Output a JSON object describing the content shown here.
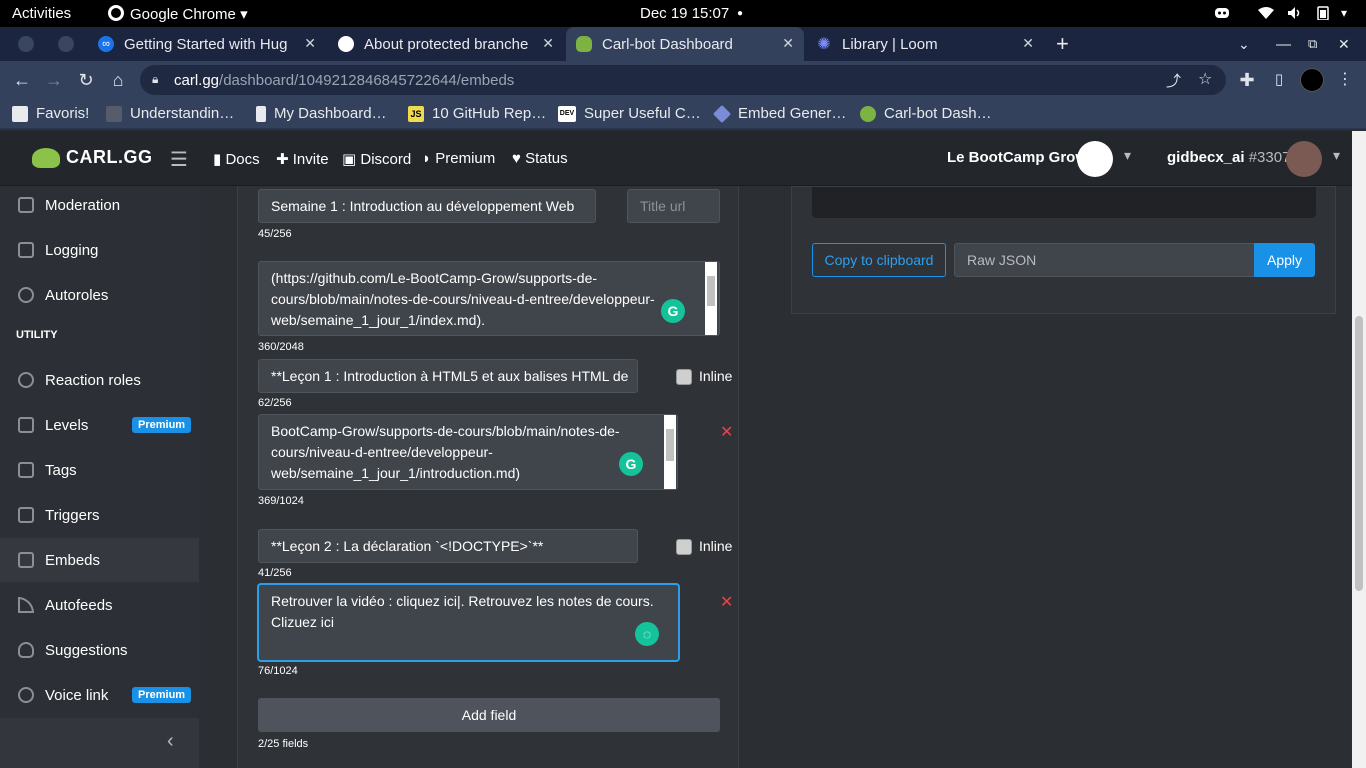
{
  "os": {
    "activities": "Activities",
    "app_name": "Google Chrome",
    "clock": "Dec 19  15:07"
  },
  "tabs": [
    {
      "label": "Getting Started with Hug"
    },
    {
      "label": "About protected branche"
    },
    {
      "label": "Carl-bot Dashboard"
    },
    {
      "label": "Library | Loom"
    }
  ],
  "address": {
    "host": "carl.gg",
    "path": "/dashboard/1049212846845722644/embeds"
  },
  "bookmarks": [
    {
      "label": "Favoris!",
      "icon": "folder-icon"
    },
    {
      "label": "Understandin…",
      "icon": "bookmark-icon"
    },
    {
      "label": "My Dashboard…",
      "icon": "bookmark-icon"
    },
    {
      "label": "10 GitHub Rep…",
      "icon": "js-icon",
      "badge": "JS"
    },
    {
      "label": "Super Useful C…",
      "icon": "dev-icon",
      "badge": "DEV"
    },
    {
      "label": "Embed Gener…",
      "icon": "embed-icon"
    },
    {
      "label": "Carl-bot Dash…",
      "icon": "turtle-icon"
    }
  ],
  "header": {
    "logo": "CARL.GG",
    "nav": [
      "Docs",
      "Invite",
      "Discord",
      "Premium",
      "Status"
    ],
    "server": "Le BootCamp Grow",
    "user": "gidbecx_ai",
    "discriminator": "#3307"
  },
  "sidebar": {
    "section_label": "UTILITY",
    "premium_badge": "Premium",
    "items": [
      {
        "label": "Moderation"
      },
      {
        "label": "Logging"
      },
      {
        "label": "Autoroles"
      },
      {
        "label": "Reaction roles"
      },
      {
        "label": "Levels",
        "premium": true
      },
      {
        "label": "Tags"
      },
      {
        "label": "Triggers"
      },
      {
        "label": "Embeds",
        "active": true
      },
      {
        "label": "Autofeeds"
      },
      {
        "label": "Suggestions"
      },
      {
        "label": "Voice link",
        "premium": true
      }
    ]
  },
  "editor": {
    "title_value": "Semaine 1 : Introduction au développement Web",
    "title_url_placeholder": "Title url",
    "title_count": "45/256",
    "description_lines": [
      "(https://github.com/Le-BootCamp-Grow/supports-de-",
      "cours/blob/main/notes-de-cours/niveau-d-entree/developpeur-",
      "web/semaine_1_jour_1/index.md)."
    ],
    "description_count": "360/2048",
    "inline_label": "Inline",
    "fields": [
      {
        "name": "**Leçon 1 : Introduction à HTML5 et aux balises HTML de",
        "name_count": "62/256",
        "value_lines": [
          "BootCamp-Grow/supports-de-cours/blob/main/notes-de-",
          "cours/niveau-d-entree/developpeur-",
          "web/semaine_1_jour_1/introduction.md)"
        ],
        "value_count": "369/1024"
      },
      {
        "name": "**Leçon 2 : La déclaration `<!DOCTYPE>`**",
        "name_count": "41/256",
        "value_lines": [
          "Retrouver la vidéo : cliquez ici|. Retrouvez les notes de cours.",
          "Clizuez ici"
        ],
        "value_count": "76/1024"
      }
    ],
    "add_field_label": "Add field",
    "fields_count": "2/25 fields"
  },
  "preview": {
    "copy_label": "Copy to clipboard",
    "raw_json_placeholder": "Raw JSON",
    "apply_label": "Apply"
  },
  "colors": {
    "accent": "#1991e6",
    "danger": "#ed4245",
    "grammarly": "#15c39a"
  }
}
